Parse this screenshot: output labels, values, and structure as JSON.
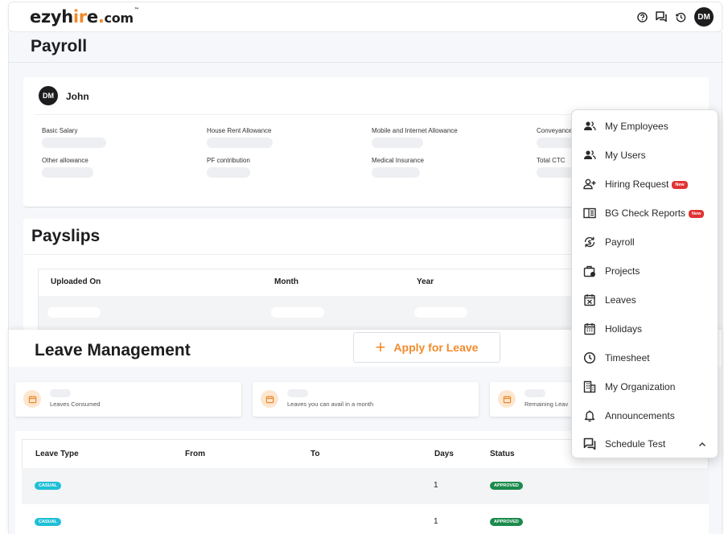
{
  "app": {
    "logo_main": "ezyh",
    "logo_accent": "ir",
    "logo_tail": "e",
    "logo_accent2": ".",
    "logo_domain": "com",
    "logo_tm": "™",
    "avatar_initials": "DM",
    "brand_color": "#f08b2b"
  },
  "top_icons": [
    "help-circle-icon",
    "chat-icon",
    "history-icon"
  ],
  "payroll": {
    "title": "Payroll",
    "employee_initials": "DM",
    "employee_name": "John",
    "fields_row1": [
      "Basic Salary",
      "House Rent Allowance",
      "Mobile and Internet Allowance",
      "Conveyance"
    ],
    "fields_row2": [
      "Other allowance",
      "PF contribution",
      "Medical Insurance",
      "Total CTC"
    ]
  },
  "payslips": {
    "title": "Payslips",
    "columns": [
      "Uploaded On",
      "Month",
      "Year"
    ]
  },
  "leave": {
    "title": "Leave Management",
    "apply_button": "Apply for Leave",
    "stats": [
      "Leaves Consumed",
      "Leaves you can avail in a month",
      "Remaining Leav"
    ],
    "columns": [
      "Leave Type",
      "From",
      "To",
      "Days",
      "Status"
    ],
    "rows": [
      {
        "type": "CASUAL",
        "from": "",
        "to": "",
        "days": "1",
        "status": "APPROVED"
      },
      {
        "type": "CASUAL",
        "from": "",
        "to": "",
        "days": "1",
        "status": "APPROVED"
      }
    ]
  },
  "menu": {
    "items": [
      {
        "label": "My Employees",
        "icon": "people-icon"
      },
      {
        "label": "My Users",
        "icon": "people-icon"
      },
      {
        "label": "Hiring Request",
        "icon": "person-add-icon",
        "badge": "New"
      },
      {
        "label": "BG Check Reports",
        "icon": "report-icon",
        "badge": "New"
      },
      {
        "label": "Payroll",
        "icon": "payroll-icon"
      },
      {
        "label": "Projects",
        "icon": "briefcase-icon"
      },
      {
        "label": "Leaves",
        "icon": "calendar-x-icon"
      },
      {
        "label": "Holidays",
        "icon": "calendar-icon"
      },
      {
        "label": "Timesheet",
        "icon": "clock-icon"
      },
      {
        "label": "My Organization",
        "icon": "building-icon"
      },
      {
        "label": "Announcements",
        "icon": "bell-icon"
      },
      {
        "label": "Schedule Test",
        "icon": "chat-icon"
      }
    ]
  }
}
